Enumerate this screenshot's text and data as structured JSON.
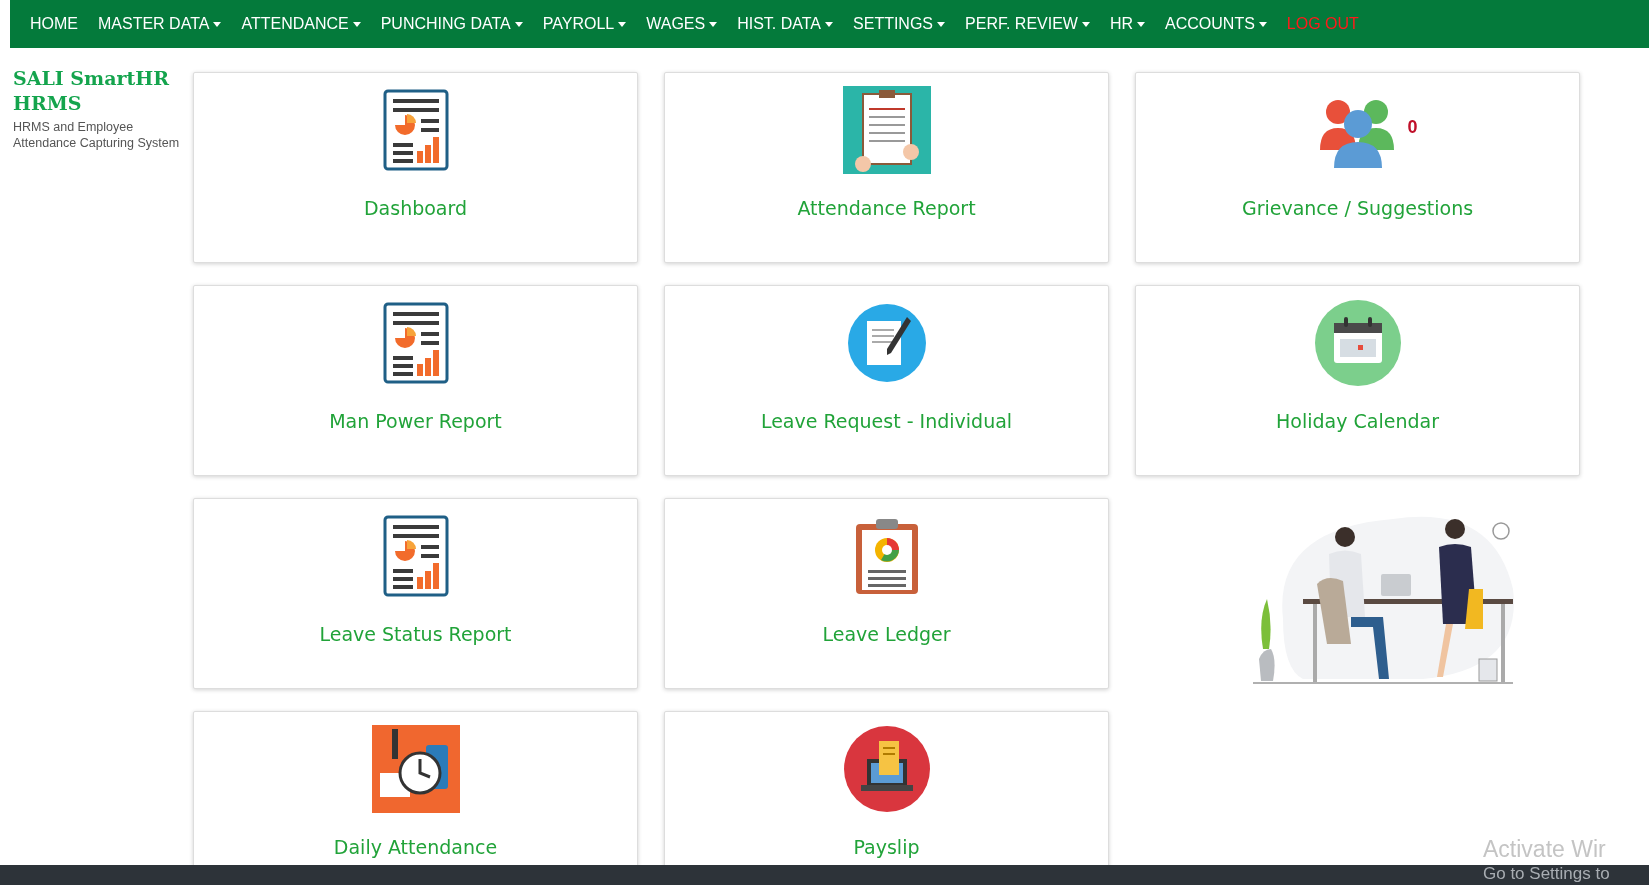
{
  "nav": {
    "items": [
      {
        "label": "HOME",
        "kind": "link"
      },
      {
        "label": "MASTER DATA",
        "kind": "dropdown"
      },
      {
        "label": "ATTENDANCE",
        "kind": "dropdown"
      },
      {
        "label": "PUNCHING DATA",
        "kind": "dropdown"
      },
      {
        "label": "PAYROLL",
        "kind": "dropdown"
      },
      {
        "label": "WAGES",
        "kind": "dropdown"
      },
      {
        "label": "HIST. DATA",
        "kind": "dropdown"
      },
      {
        "label": "SETTINGS",
        "kind": "dropdown"
      },
      {
        "label": "PERF. REVIEW",
        "kind": "dropdown"
      },
      {
        "label": "HR",
        "kind": "dropdown"
      },
      {
        "label": "ACCOUNTS",
        "kind": "dropdown"
      },
      {
        "label": "LOG OUT",
        "kind": "logout"
      }
    ]
  },
  "brand": {
    "title": "SALI SmartHR HRMS",
    "subtitle": "HRMS and Employee Attendance Capturing System"
  },
  "tiles": [
    {
      "label": "Dashboard",
      "kind": "report"
    },
    {
      "label": "Attendance Report",
      "kind": "attendance"
    },
    {
      "label": "Grievance / Suggestions",
      "kind": "group",
      "badge": "0"
    },
    {
      "label": "Man Power Report",
      "kind": "report"
    },
    {
      "label": "Leave Request - Individual",
      "kind": "request"
    },
    {
      "label": "Holiday Calendar",
      "kind": "calendar"
    },
    {
      "label": "Leave Status Report",
      "kind": "report"
    },
    {
      "label": "Leave Ledger",
      "kind": "ledger"
    },
    {
      "label": "Daily Attendance",
      "kind": "clock"
    },
    {
      "label": "Payslip",
      "kind": "payslip"
    }
  ],
  "os_notice": {
    "line1": "Activate Wir",
    "line2": "Go to Settings to"
  }
}
